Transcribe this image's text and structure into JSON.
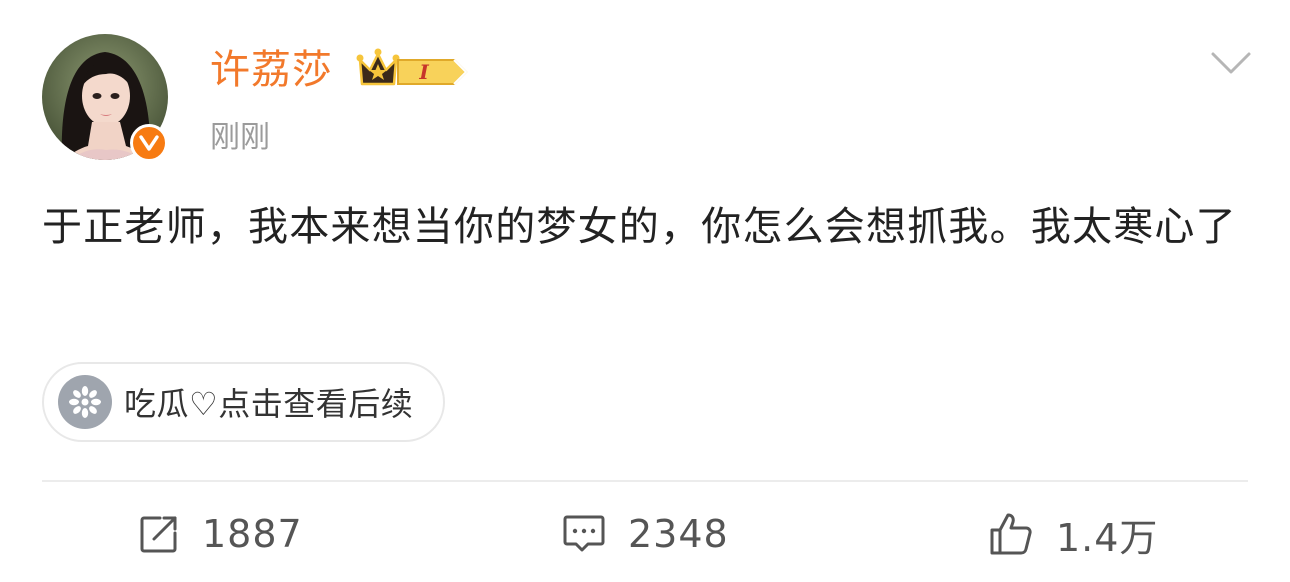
{
  "post": {
    "author": {
      "name": "许荔莎",
      "vip_level": "I",
      "verified": true,
      "accent_color": "#f2792b"
    },
    "timestamp": "刚刚",
    "text": "于正老师，我本来想当你的梦女的，你怎么会想抓我。我太寒心了",
    "topic": {
      "icon": "melon-icon",
      "label": "吃瓜♡点击查看后续"
    },
    "actions": {
      "repost": {
        "icon": "repost-icon",
        "count": "1887"
      },
      "comment": {
        "icon": "comment-icon",
        "count": "2348"
      },
      "like": {
        "icon": "thumbs-up-icon",
        "count": "1.4万"
      }
    }
  }
}
